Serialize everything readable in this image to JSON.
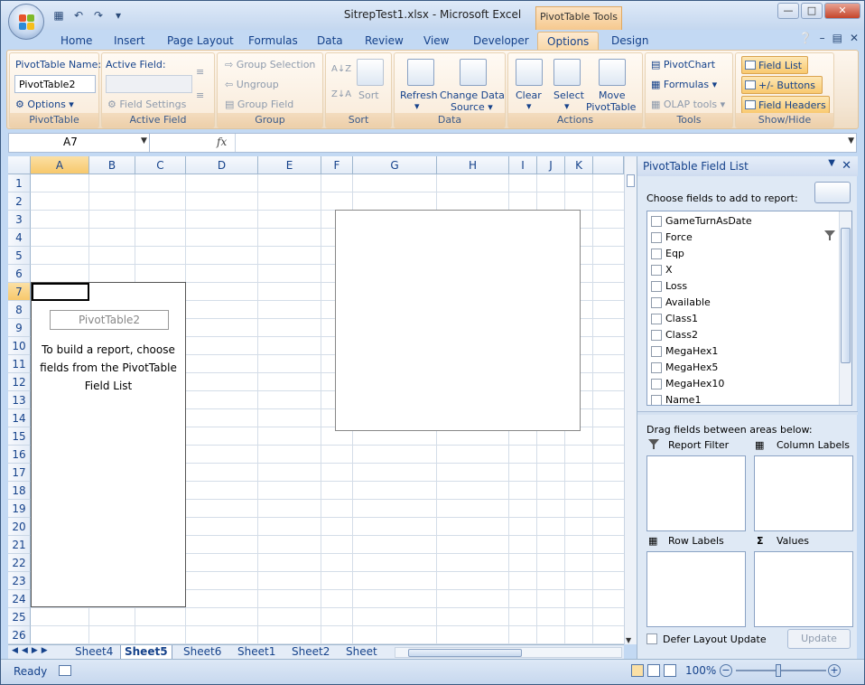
{
  "window": {
    "title": "SitrepTest1.xlsx - Microsoft Excel",
    "context_tab": "PivotTable Tools"
  },
  "tabs": [
    "Home",
    "Insert",
    "Page Layout",
    "Formulas",
    "Data",
    "Review",
    "View",
    "Developer",
    "Options",
    "Design"
  ],
  "active_tab": "Options",
  "ribbon": {
    "pivottable": {
      "name_label": "PivotTable Name:",
      "name_value": "PivotTable2",
      "options_label": "Options",
      "group_label": "PivotTable"
    },
    "active_field": {
      "label": "Active Field:",
      "settings_label": "Field Settings",
      "group_label": "Active Field"
    },
    "group": {
      "selection": "Group Selection",
      "ungroup": "Ungroup",
      "field": "Group Field",
      "group_label": "Group"
    },
    "sort": {
      "sort_label": "Sort",
      "group_label": "Sort"
    },
    "data": {
      "refresh": "Refresh",
      "change_source_1": "Change Data",
      "change_source_2": "Source",
      "group_label": "Data"
    },
    "actions": {
      "clear": "Clear",
      "select": "Select",
      "move_1": "Move",
      "move_2": "PivotTable",
      "group_label": "Actions"
    },
    "tools": {
      "pivotchart": "PivotChart",
      "formulas": "Formulas",
      "olap": "OLAP tools",
      "group_label": "Tools"
    },
    "showhide": {
      "field_list": "Field List",
      "buttons": "+/- Buttons",
      "headers": "Field Headers",
      "group_label": "Show/Hide"
    }
  },
  "formula_bar": {
    "name_box": "A7",
    "fx": "fx",
    "content": ""
  },
  "columns": [
    "A",
    "B",
    "C",
    "D",
    "E",
    "F",
    "G",
    "H",
    "I",
    "J",
    "K"
  ],
  "rows": [
    "1",
    "2",
    "3",
    "4",
    "5",
    "6",
    "7",
    "8",
    "9",
    "10",
    "11",
    "12",
    "13",
    "14",
    "15",
    "16",
    "17",
    "18",
    "19",
    "20",
    "21",
    "22",
    "23",
    "24",
    "25",
    "26"
  ],
  "pivot_placeholder": {
    "name": "PivotTable2",
    "message_1": "To build a report, choose",
    "message_2": "fields from the PivotTable",
    "message_3": "Field List"
  },
  "sheets": [
    "Sheet4",
    "Sheet5",
    "Sheet6",
    "Sheet1",
    "Sheet2",
    "Sheet"
  ],
  "active_sheet": "Sheet5",
  "status": {
    "ready": "Ready",
    "zoom": "100%"
  },
  "field_pane": {
    "title": "PivotTable Field List",
    "choose_label": "Choose fields to add to report:",
    "fields": [
      "GameTurnAsDate",
      "Force",
      "Eqp",
      "X",
      "Loss",
      "Available",
      "Class1",
      "Class2",
      "MegaHex1",
      "MegaHex5",
      "MegaHex10",
      "Name1"
    ],
    "drag_label": "Drag fields between areas below:",
    "areas": {
      "report_filter": "Report Filter",
      "column_labels": "Column Labels",
      "row_labels": "Row Labels",
      "values": "Values"
    },
    "defer_label": "Defer Layout Update",
    "update_label": "Update"
  }
}
